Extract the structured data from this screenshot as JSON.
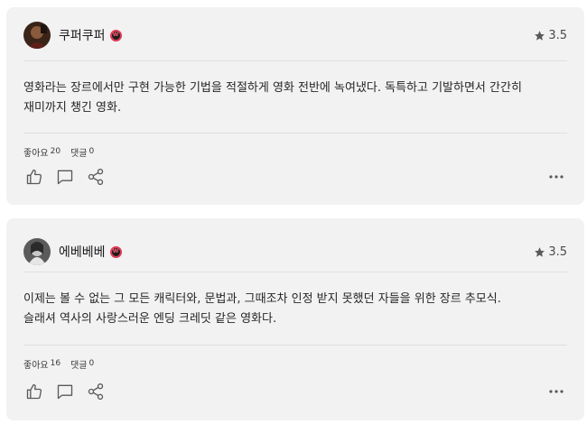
{
  "comments": [
    {
      "author": "쿠퍼쿠퍼",
      "rating": "3.5",
      "text_lines": [
        "영화라는 장르에서만 구현 가능한 기법을 적절하게 영화 전반에 녹여냈다. 독특하고 기발하면서 간간히",
        "재미까지 챙긴 영화."
      ],
      "likes_label": "좋아요",
      "likes_count": "20",
      "replies_label": "댓글",
      "replies_count": "0"
    },
    {
      "author": "에베베베",
      "rating": "3.5",
      "text_lines": [
        "이제는 볼 수 없는 그 모든 캐릭터와, 문법과, 그때조차 인정 받지 못했던 자들을 위한 장르 추모식.",
        "슬래셔 역사의 사랑스러운 엔딩 크레딧 같은 영화다."
      ],
      "likes_label": "좋아요",
      "likes_count": "16",
      "replies_label": "댓글",
      "replies_count": "0"
    }
  ],
  "icons": {
    "rating": "star-icon",
    "badge": "verified-badge-icon",
    "like": "thumbs-up-icon",
    "comment": "comment-icon",
    "share": "share-icon",
    "more": "more-options-icon"
  },
  "colors": {
    "card_bg": "#f2f2f3",
    "badge_ring": "#e03a55",
    "icon": "#5a5a5a"
  }
}
